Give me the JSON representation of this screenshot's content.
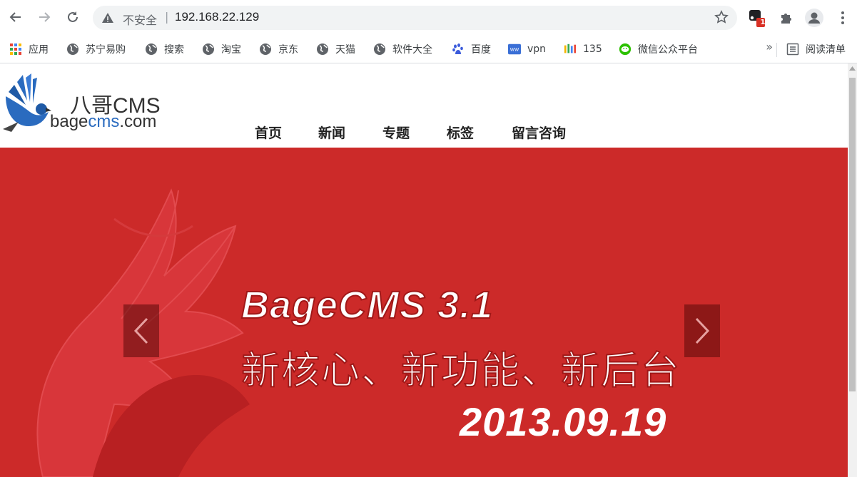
{
  "browser": {
    "security_label": "不安全",
    "url": "192.168.22.129",
    "extension_badge": "1"
  },
  "bookmarks": [
    {
      "label": "应用",
      "icon": "apps-grid-icon"
    },
    {
      "label": "苏宁易购",
      "icon": "globe-icon"
    },
    {
      "label": "搜索",
      "icon": "globe-icon"
    },
    {
      "label": "淘宝",
      "icon": "globe-icon"
    },
    {
      "label": "京东",
      "icon": "globe-icon"
    },
    {
      "label": "天猫",
      "icon": "globe-icon"
    },
    {
      "label": "软件大全",
      "icon": "globe-icon"
    },
    {
      "label": "百度",
      "icon": "baidu-paw-icon"
    },
    {
      "label": "vpn",
      "icon": "vpn-icon"
    },
    {
      "label": "135",
      "icon": "135-editor-icon"
    },
    {
      "label": "微信公众平台",
      "icon": "wechat-icon"
    }
  ],
  "bookmarks_more": "»",
  "reading_list": "阅读清单",
  "site": {
    "logo_title": "八哥CMS",
    "logo_domain_a": "bage",
    "logo_domain_b": "cms",
    "logo_domain_c": ".com",
    "menu": [
      "首页",
      "新闻",
      "专题",
      "标签",
      "留言咨询"
    ]
  },
  "banner": {
    "title": "BageCMS 3.1",
    "subtitle": "新核心、新功能、新后台",
    "date": "2013.09.19",
    "background": "#cc2a29"
  }
}
